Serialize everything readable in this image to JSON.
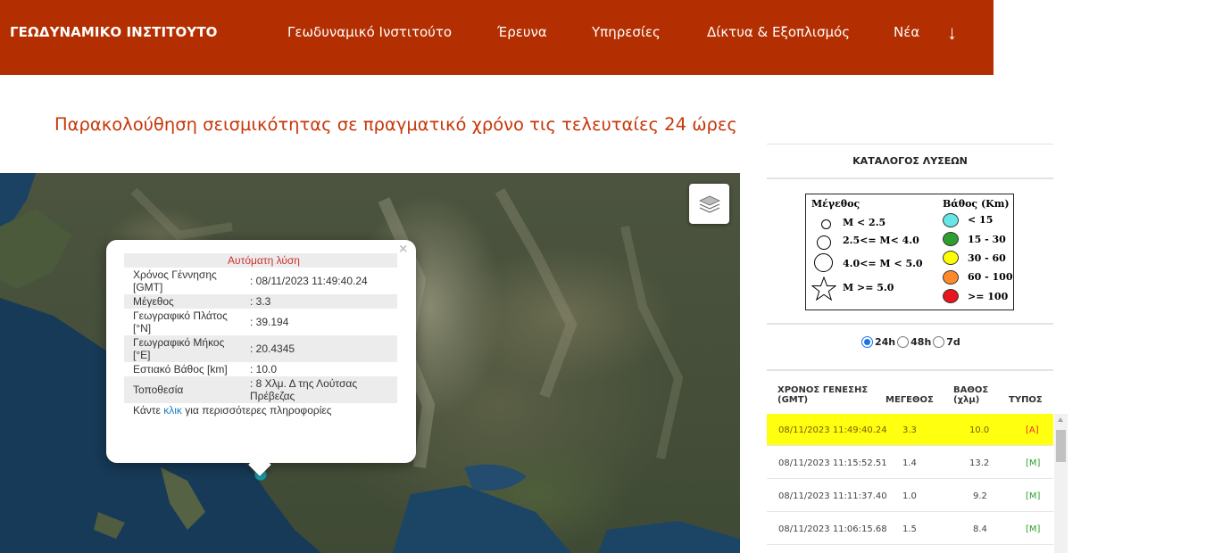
{
  "nav": {
    "brand": "ΓΕΩΔΥΝΑΜΙΚΟ ΙΝΣΤΙΤΟΥΤΟ",
    "links": [
      "Γεωδυναμικό Ινστιτούτο",
      "Έρευνα",
      "Υπηρεσίες",
      "Δίκτυα & Εξοπλισμός",
      "Νέα"
    ],
    "more_icon": "arrow-down-icon",
    "color": "#b32e00"
  },
  "page": {
    "title": "Παρακολούθηση σεισμικότητας σε πραγματικό χρόνο τις τελευταίες 24 ώρες",
    "title_color": "#c8380a"
  },
  "popup": {
    "header": "Αυτόματη λύση",
    "close": "×",
    "rows": [
      {
        "label": "Χρόνος Γέννησης [GMT]",
        "value": ": 08/11/2023 11:49:40.24"
      },
      {
        "label": "Μέγεθος",
        "value": ": 3.3"
      },
      {
        "label": "Γεωγραφικό Πλάτος [°N]",
        "value": ": 39.194"
      },
      {
        "label": "Γεωγραφικό Μήκος [°E]",
        "value": ": 20.4345"
      },
      {
        "label": "Εστιακό Βάθος [km]",
        "value": ": 10.0"
      },
      {
        "label": "Τοποθεσία",
        "value": ": 8 Χλμ. Δ της Λούτσας Πρέβεζας"
      }
    ],
    "footer_pre": "Κάντε ",
    "footer_link": "κλικ",
    "footer_post": " για περισσότερες πληροφορίες"
  },
  "map": {
    "layers_icon": "layers-icon",
    "marker_color": "#22a3b2"
  },
  "sidebar": {
    "title": "ΚΑΤΑΛΟΓΟΣ ΛΥΣΕΩΝ",
    "legend": {
      "magnitude_title": "Μέγεθος",
      "depth_title": "Βάθος (Km)",
      "magnitudes": [
        "M < 2.5",
        "2.5<= M< 4.0",
        "4.0<= M < 5.0",
        "M >= 5.0"
      ],
      "depths": [
        {
          "label": "< 15",
          "color": "#66e6e6"
        },
        {
          "label": "15 - 30",
          "color": "#2e9e2e"
        },
        {
          "label": "30 - 60",
          "color": "#ffff00"
        },
        {
          "label": "60 - 100",
          "color": "#ff8a2a"
        },
        {
          "label": ">= 100",
          "color": "#e8141e"
        }
      ]
    },
    "periods": [
      "24h",
      "48h",
      "7d"
    ],
    "selected_period": "24h",
    "columns": [
      "ΧΡΟΝΟΣ ΓΕΝΕΣΗΣ (GMT)",
      "ΜΕΓΕΘΟΣ",
      "ΒΑΘΟΣ (χλμ)",
      "ΤΥΠΟΣ"
    ],
    "events": [
      {
        "time": "08/11/2023 11:49:40.24",
        "mag": "3.3",
        "depth": "10.0",
        "type": "[A]",
        "type_color": "#e8321e",
        "selected": true
      },
      {
        "time": "08/11/2023 11:15:52.51",
        "mag": "1.4",
        "depth": "13.2",
        "type": "[M]",
        "type_color": "#2e9e2e",
        "selected": false
      },
      {
        "time": "08/11/2023 11:11:37.40",
        "mag": "1.0",
        "depth": "9.2",
        "type": "[M]",
        "type_color": "#2e9e2e",
        "selected": false
      },
      {
        "time": "08/11/2023 11:06:15.68",
        "mag": "1.5",
        "depth": "8.4",
        "type": "[M]",
        "type_color": "#2e9e2e",
        "selected": false
      }
    ]
  }
}
